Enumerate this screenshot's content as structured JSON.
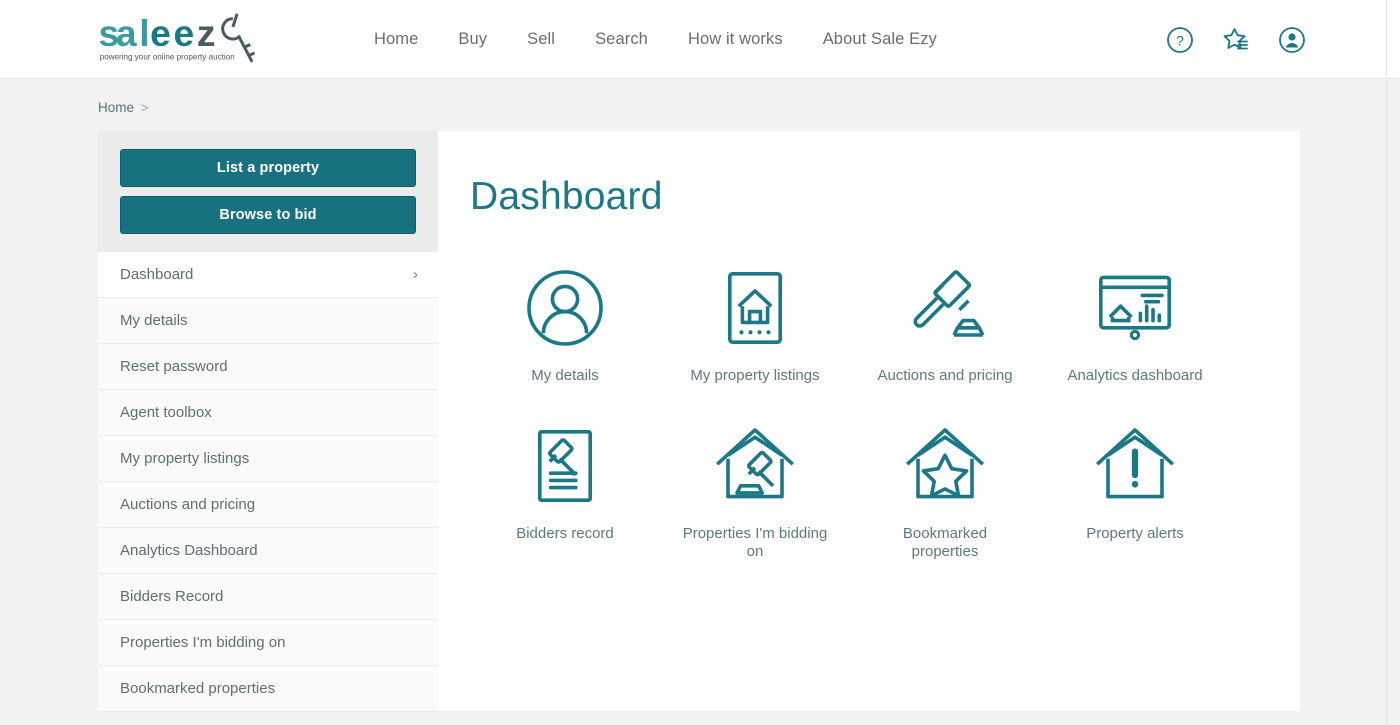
{
  "header": {
    "logo_text": "saleezy",
    "logo_tagline": "powering your online property auction",
    "nav": [
      {
        "label": "Home"
      },
      {
        "label": "Buy"
      },
      {
        "label": "Sell"
      },
      {
        "label": "Search"
      },
      {
        "label": "How it works"
      },
      {
        "label": "About Sale Ezy"
      }
    ],
    "icons": [
      {
        "name": "help-icon",
        "glyph": "?"
      },
      {
        "name": "watchlist-star-icon",
        "glyph": "star"
      },
      {
        "name": "account-avatar-icon",
        "glyph": "user"
      }
    ]
  },
  "breadcrumb": {
    "items": [
      {
        "label": "Home"
      }
    ],
    "separator": ">"
  },
  "sidebar": {
    "buttons": [
      {
        "label": "List a property"
      },
      {
        "label": "Browse to bid"
      }
    ],
    "items": [
      {
        "label": "Dashboard",
        "active": true,
        "chevron": "›"
      },
      {
        "label": "My details",
        "active": false
      },
      {
        "label": "Reset password",
        "active": false
      },
      {
        "label": "Agent toolbox",
        "active": false
      },
      {
        "label": "My property listings",
        "active": false
      },
      {
        "label": "Auctions and pricing",
        "active": false
      },
      {
        "label": "Analytics Dashboard",
        "active": false
      },
      {
        "label": "Bidders Record",
        "active": false
      },
      {
        "label": "Properties I'm bidding on",
        "active": false
      },
      {
        "label": "Bookmarked properties",
        "active": false
      }
    ]
  },
  "main": {
    "title": "Dashboard",
    "tiles": [
      {
        "label": "My details",
        "icon": "person-circle-icon"
      },
      {
        "label": "My property listings",
        "icon": "house-document-icon"
      },
      {
        "label": "Auctions and pricing",
        "icon": "gavel-icon"
      },
      {
        "label": "Analytics dashboard",
        "icon": "presentation-chart-icon"
      },
      {
        "label": "Bidders record",
        "icon": "gavel-document-icon"
      },
      {
        "label": "Properties I'm bidding on",
        "icon": "house-gavel-icon"
      },
      {
        "label": "Bookmarked properties",
        "icon": "house-star-icon"
      },
      {
        "label": "Property alerts",
        "icon": "house-alert-icon"
      }
    ]
  },
  "colors": {
    "teal": "#17717e",
    "title_teal": "#1b7886",
    "label_grey": "#5b7a80",
    "page_bg": "#f2f2f2",
    "logo_teal": "#3f9aa0",
    "logo_dark": "#4c5a62"
  }
}
